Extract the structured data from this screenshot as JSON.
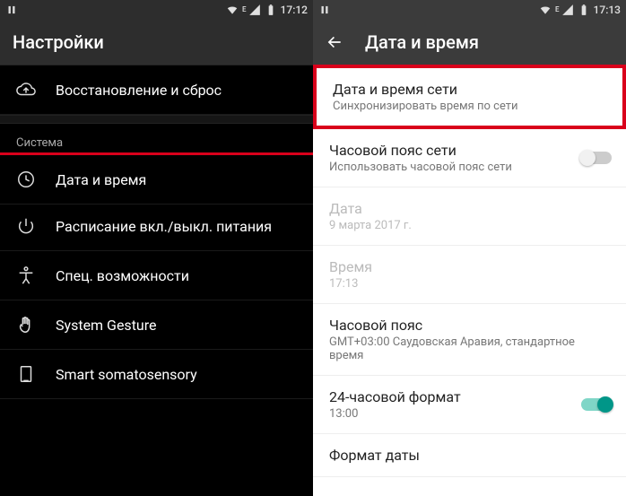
{
  "left": {
    "status": {
      "time": "17:12"
    },
    "title": "Настройки",
    "section": "Система",
    "items": [
      {
        "label": "Восстановление и сброс"
      },
      {
        "label": "Дата и время"
      },
      {
        "label": "Расписание вкл./выкл. питания"
      },
      {
        "label": "Спец. возможности"
      },
      {
        "label": "System Gesture"
      },
      {
        "label": "Smart somatosensory"
      }
    ]
  },
  "right": {
    "status": {
      "time": "17:13"
    },
    "title": "Дата и время",
    "rows": [
      {
        "title": "Дата и время сети",
        "sub": "Синхронизировать время по сети"
      },
      {
        "title": "Часовой пояс сети",
        "sub": "Использовать часовой пояс сети"
      },
      {
        "title": "Дата",
        "sub": "9 марта 2017 г."
      },
      {
        "title": "Время",
        "sub": "17:13"
      },
      {
        "title": "Часовой пояс",
        "sub": "GMT+03:00 Саудовская Аравия, стандартное время"
      },
      {
        "title": "24-часовой формат",
        "sub": "13:00"
      },
      {
        "title": "Формат даты",
        "sub": ""
      }
    ]
  }
}
